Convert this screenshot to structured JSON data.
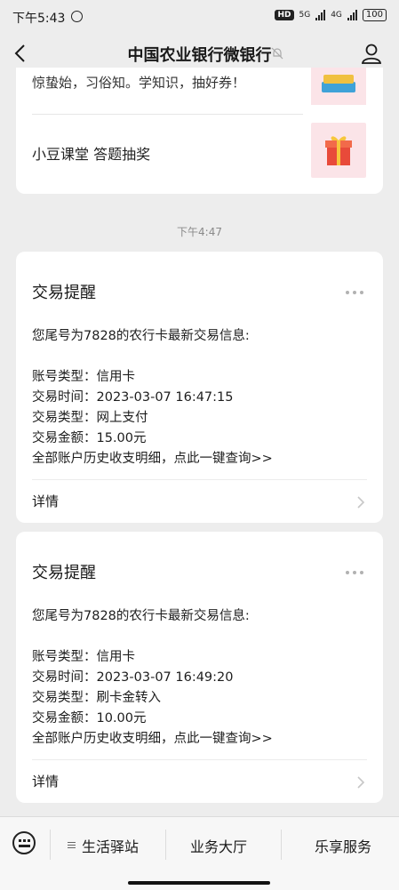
{
  "status": {
    "time": "下午5:43",
    "hd": "HD",
    "net1": "5G",
    "net2": "4G",
    "battery": "100"
  },
  "header": {
    "title": "中国农业银行微银行"
  },
  "top_card": {
    "line1": "惊蛰始，习俗知。学知识，抽好券！",
    "line2": "小豆课堂 答题抽奖"
  },
  "timestamp": "下午4:47",
  "messages": [
    {
      "title": "交易提醒",
      "intro": "您尾号为7828的农行卡最新交易信息:",
      "account_type": "账号类型：信用卡",
      "txn_time": "交易时间：2023-03-07 16:47:15",
      "txn_type": "交易类型：网上支付",
      "amount": "交易金额：15.00元",
      "history": "全部账户历史收支明细，点此一键查询>>",
      "detail": "详情"
    },
    {
      "title": "交易提醒",
      "intro": "您尾号为7828的农行卡最新交易信息:",
      "account_type": "账号类型：信用卡",
      "txn_time": "交易时间：2023-03-07 16:49:20",
      "txn_type": "交易类型：刷卡金转入",
      "amount": "交易金额：10.00元",
      "history": "全部账户历史收支明细，点此一键查询>>",
      "detail": "详情"
    }
  ],
  "bottom_menu": {
    "tab1": "生活驿站",
    "tab2": "业务大厅",
    "tab3": "乐享服务"
  }
}
